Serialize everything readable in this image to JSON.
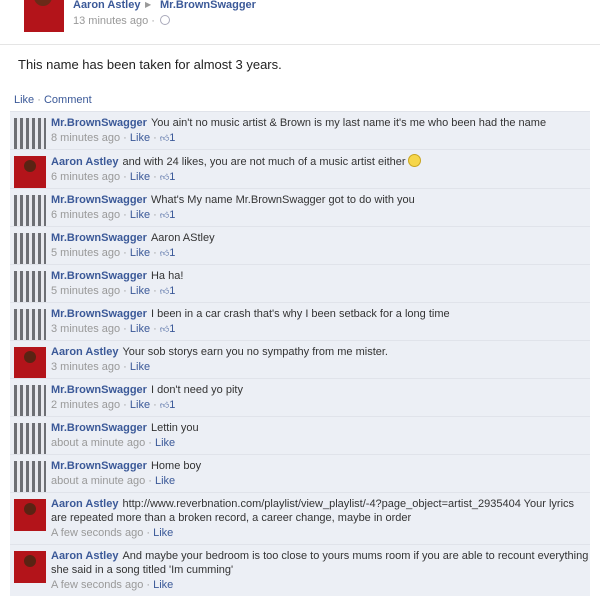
{
  "post": {
    "author": "Aaron Astley",
    "target": "Mr.BrownSwagger",
    "time": "13 minutes ago ·",
    "body": "This name has been taken for almost 3 years."
  },
  "actions": {
    "like": "Like",
    "sep": "·",
    "comment": "Comment"
  },
  "comments": [
    {
      "avatar": "brown",
      "author": "Mr.BrownSwagger",
      "text": "You ain't no music artist & Brown is my last name it's me who been had the name",
      "time": "8 minutes ago ·",
      "like": "Like",
      "likes": "1"
    },
    {
      "avatar": "aaron",
      "author": "Aaron Astley",
      "text": "and with 24 likes, you are not much of a music artist either",
      "time": "6 minutes ago ·",
      "like": "Like",
      "likes": "1"
    },
    {
      "avatar": "brown",
      "author": "Mr.BrownSwagger",
      "text": "What's My name Mr.BrownSwagger got to do with you",
      "time": "6 minutes ago ·",
      "like": "Like",
      "likes": "1"
    },
    {
      "avatar": "brown",
      "author": "Mr.BrownSwagger",
      "text": "Aaron AStley",
      "time": "5 minutes ago ·",
      "like": "Like",
      "likes": "1"
    },
    {
      "avatar": "brown",
      "author": "Mr.BrownSwagger",
      "text": "Ha ha!",
      "time": "5 minutes ago ·",
      "like": "Like",
      "likes": "1"
    },
    {
      "avatar": "brown",
      "author": "Mr.BrownSwagger",
      "text": "I been in a car crash that's why I been setback for a long time",
      "time": "3 minutes ago ·",
      "like": "Like",
      "likes": "1"
    },
    {
      "avatar": "aaron",
      "author": "Aaron Astley",
      "text": "Your sob storys earn you no sympathy from me mister.",
      "time": "3 minutes ago ·",
      "like": "Like",
      "likes": ""
    },
    {
      "avatar": "brown",
      "author": "Mr.BrownSwagger",
      "text": "I don't need yo pity",
      "time": "2 minutes ago ·",
      "like": "Like",
      "likes": "1"
    },
    {
      "avatar": "brown",
      "author": "Mr.BrownSwagger",
      "text": "Lettin you",
      "time": "about a minute ago ·",
      "like": "Like",
      "likes": ""
    },
    {
      "avatar": "brown",
      "author": "Mr.BrownSwagger",
      "text": "Home boy",
      "time": "about a minute ago ·",
      "like": "Like",
      "likes": ""
    },
    {
      "avatar": "aaron",
      "author": "Aaron Astley",
      "text": "http://www.reverbnation.com/playlist/view_playlist/-4?page_object=artist_2935404 Your lyrics are repeated more than a broken record, a career change, maybe in order",
      "time": "A few seconds ago ·",
      "like": "Like",
      "likes": ""
    },
    {
      "avatar": "aaron",
      "author": "Aaron Astley",
      "text": "And maybe your bedroom is too close to yours mums room if you are able to recount everything she said in a song titled 'Im cumming'",
      "time": "A few seconds ago ·",
      "like": "Like",
      "likes": ""
    }
  ]
}
